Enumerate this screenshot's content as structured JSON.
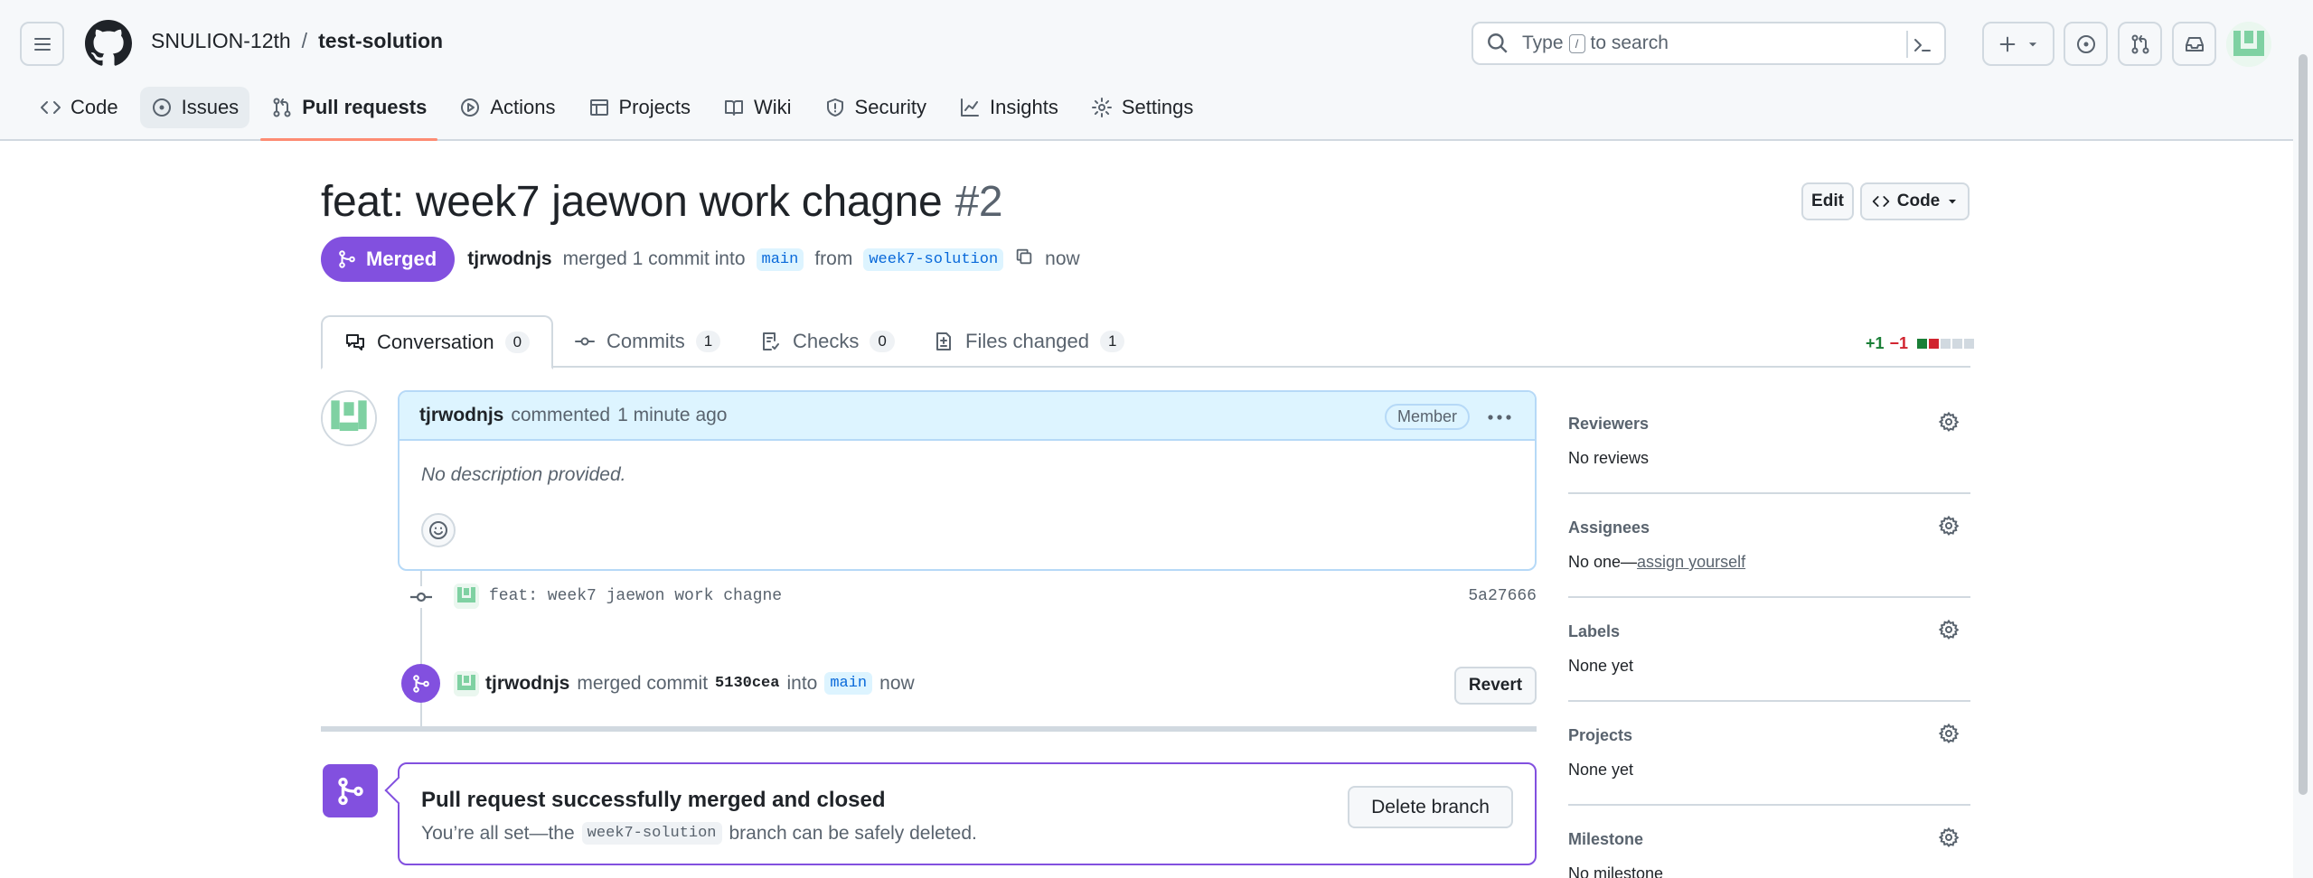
{
  "header": {
    "owner": "SNULION-12th",
    "separator": "/",
    "repo": "test-solution",
    "search_prefix": "Type",
    "search_key": "/",
    "search_suffix": "to search"
  },
  "repo_nav": [
    {
      "label": "Code",
      "icon": "code-icon"
    },
    {
      "label": "Issues",
      "icon": "issue-icon"
    },
    {
      "label": "Pull requests",
      "icon": "pull-request-icon"
    },
    {
      "label": "Actions",
      "icon": "play-icon"
    },
    {
      "label": "Projects",
      "icon": "table-icon"
    },
    {
      "label": "Wiki",
      "icon": "book-icon"
    },
    {
      "label": "Security",
      "icon": "shield-icon"
    },
    {
      "label": "Insights",
      "icon": "graph-icon"
    },
    {
      "label": "Settings",
      "icon": "gear-icon"
    }
  ],
  "pr": {
    "title": "feat: week7 jaewon work chagne",
    "number": "#2",
    "status": "Merged",
    "author": "tjrwodnjs",
    "merge_text": "merged 1 commit into",
    "base_branch": "main",
    "from_text": "from",
    "head_branch": "week7-solution",
    "time": "now",
    "edit_label": "Edit",
    "code_label": "Code"
  },
  "tabs": [
    {
      "label": "Conversation",
      "count": "0"
    },
    {
      "label": "Commits",
      "count": "1"
    },
    {
      "label": "Checks",
      "count": "0"
    },
    {
      "label": "Files changed",
      "count": "1"
    }
  ],
  "diffstat": {
    "additions": "+1",
    "deletions": "−1",
    "colors": [
      "#1a7f37",
      "#d1242f",
      "#d1d9e0",
      "#d1d9e0",
      "#d1d9e0"
    ]
  },
  "comment": {
    "author": "tjrwodnjs",
    "action": "commented",
    "time": "1 minute ago",
    "badge": "Member",
    "body": "No description provided."
  },
  "commit": {
    "message": "feat: week7 jaewon work chagne",
    "sha": "5a27666"
  },
  "merge_event": {
    "author": "tjrwodnjs",
    "text": "merged commit",
    "sha": "5130cea",
    "into_text": "into",
    "branch": "main",
    "time": "now",
    "revert_label": "Revert"
  },
  "merged_box": {
    "title": "Pull request successfully merged and closed",
    "sub_prefix": "You’re all set—the",
    "branch": "week7-solution",
    "sub_suffix": "branch can be safely deleted.",
    "delete_label": "Delete branch"
  },
  "sidebar": [
    {
      "title": "Reviewers",
      "value": "No reviews"
    },
    {
      "title": "Assignees",
      "value": "No one—",
      "link": "assign yourself"
    },
    {
      "title": "Labels",
      "value": "None yet"
    },
    {
      "title": "Projects",
      "value": "None yet"
    },
    {
      "title": "Milestone",
      "value": "No milestone"
    }
  ],
  "colors": {
    "merged": "#8250df",
    "accent_underline": "#fd8c73",
    "link": "#0969da"
  }
}
